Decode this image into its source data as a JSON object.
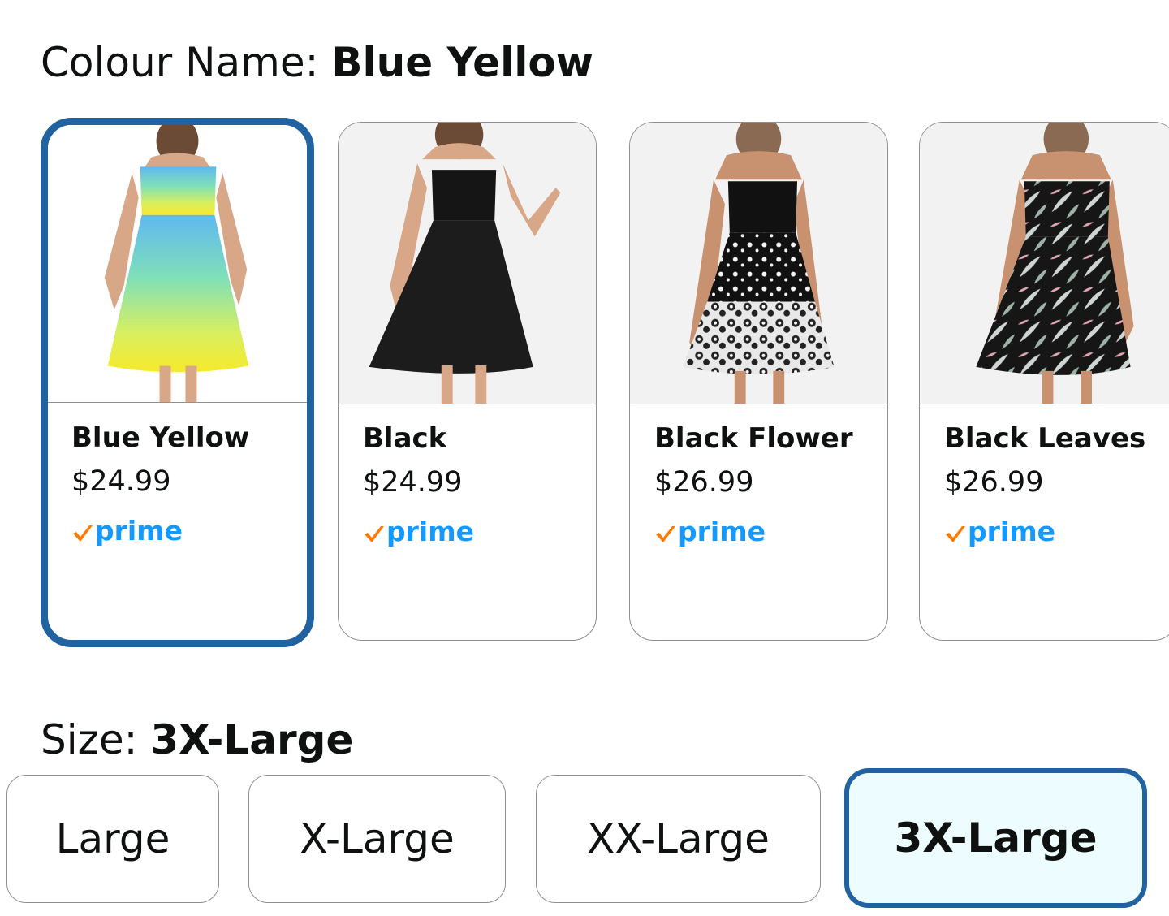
{
  "colour": {
    "heading_label": "Colour Name: ",
    "selected_value": "Blue Yellow",
    "swatches": [
      {
        "name": "Blue Yellow",
        "price": "$24.99",
        "prime": "prime",
        "dress": "gradient",
        "selected": true
      },
      {
        "name": "Black",
        "price": "$24.99",
        "prime": "prime",
        "dress": "black",
        "selected": false
      },
      {
        "name": "Black Flower",
        "price": "$26.99",
        "prime": "prime",
        "dress": "flower",
        "selected": false
      },
      {
        "name": "Black Leaves",
        "price": "$26.99",
        "prime": "prime",
        "dress": "leaves",
        "selected": false
      }
    ]
  },
  "size": {
    "heading_label": "Size: ",
    "selected_value": "3X-Large",
    "options": [
      "Large",
      "X-Large",
      "XX-Large",
      "3X-Large"
    ]
  },
  "colors": {
    "selected_border": "#2162a1",
    "selected_fill": "#edfdff",
    "prime_blue": "#1399ff",
    "prime_check": "#ff7a00"
  }
}
